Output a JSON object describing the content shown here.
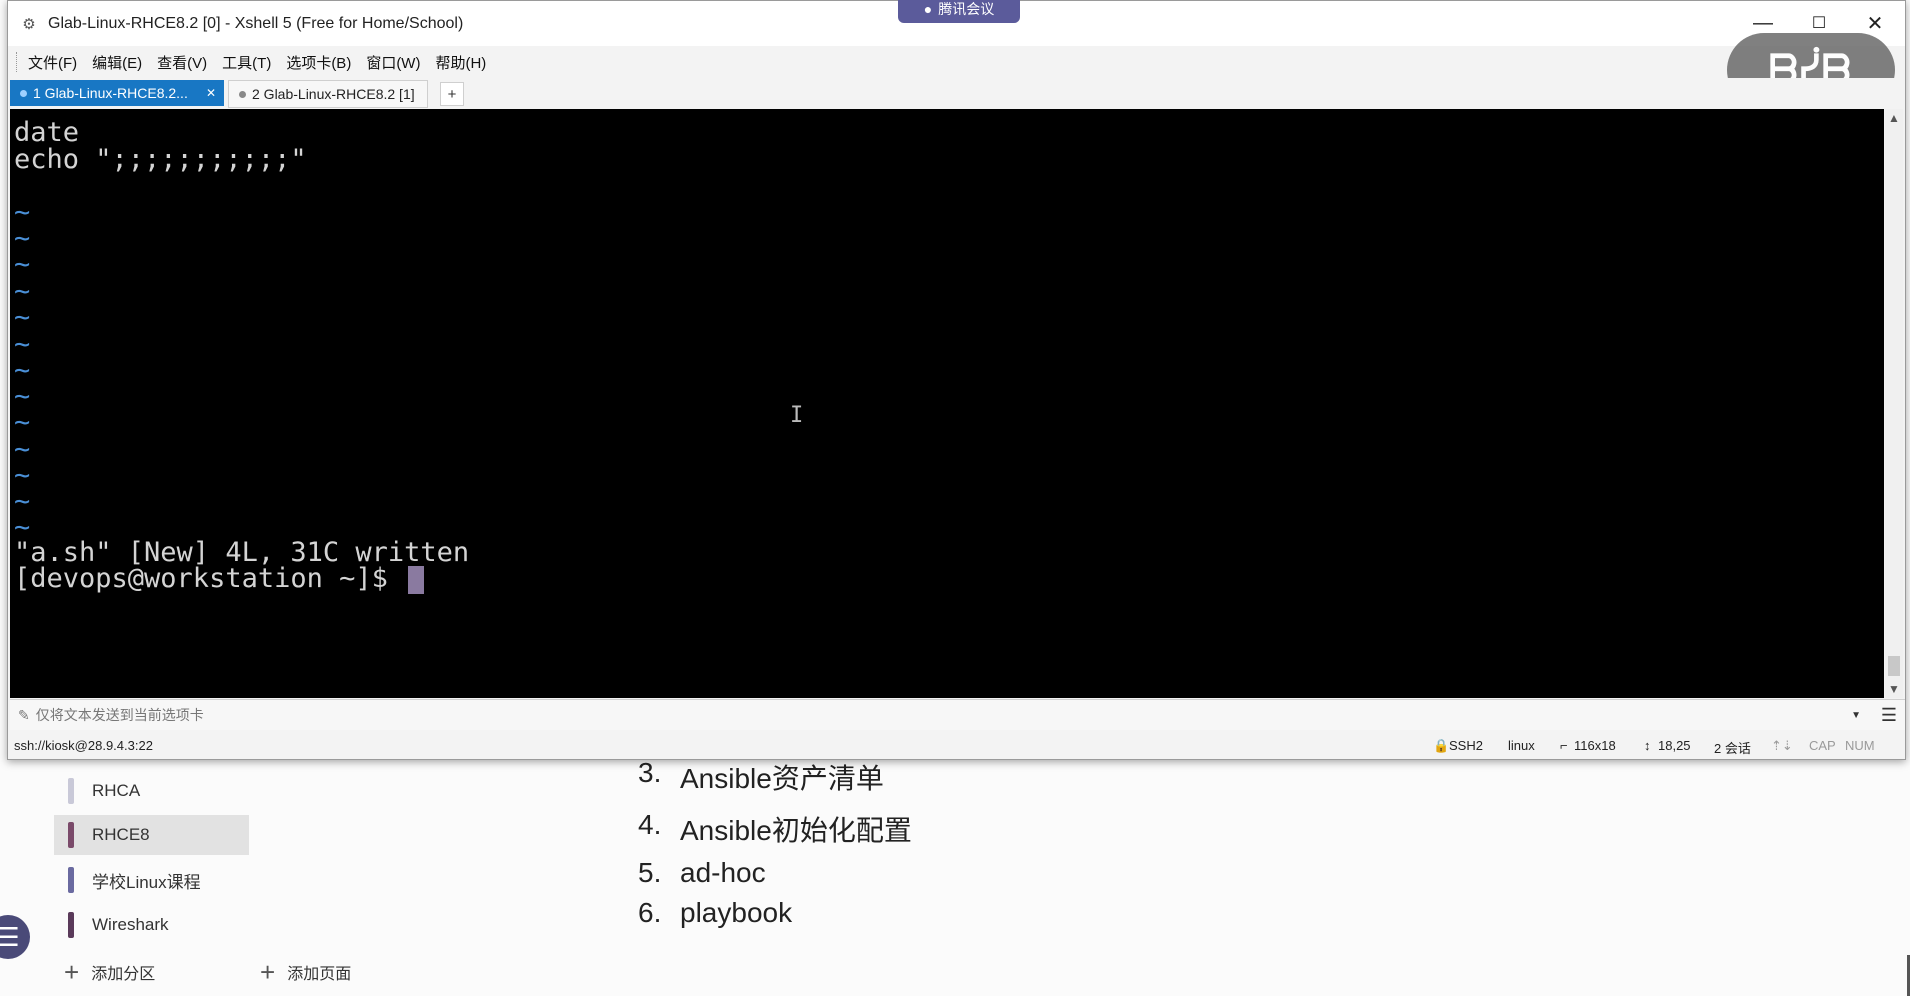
{
  "window": {
    "title": "Glab-Linux-RHCE8.2 [0] - Xshell 5 (Free for Home/School)",
    "meeting_badge": "腾讯会议"
  },
  "menu": [
    "文件(F)",
    "编辑(E)",
    "查看(V)",
    "工具(T)",
    "选项卡(B)",
    "窗口(W)",
    "帮助(H)"
  ],
  "tabs": [
    {
      "label": "1 Glab-Linux-RHCE8.2...",
      "active": true
    },
    {
      "label": "2 Glab-Linux-RHCE8.2 [1]",
      "active": false
    }
  ],
  "terminal": {
    "lines": [
      "date",
      "echo \";;;;;;;;;;;\""
    ],
    "tilde": "~",
    "status_line": "\"a.sh\" [New] 4L, 31C written",
    "prompt": "[devops@workstation ~]$"
  },
  "compose_bar": {
    "placeholder": "仅将文本发送到当前选项卡"
  },
  "statusbar": {
    "connection": "ssh://kiosk@28.9.4.3:22",
    "protocol": "SSH2",
    "term": "linux",
    "size": "116x18",
    "cursor_pos": "18,25",
    "sessions": "2 会话",
    "cap": "CAP",
    "num": "NUM"
  },
  "notebook": {
    "sections": [
      {
        "label": "RHCA",
        "color": "#c9c9d8",
        "active": false
      },
      {
        "label": "RHCE8",
        "color": "#7a4a6a",
        "active": true
      },
      {
        "label": "学校Linux课程",
        "color": "#6a6aa0",
        "active": false
      },
      {
        "label": "Wireshark",
        "color": "#5a3a5a",
        "active": false
      }
    ],
    "add_section": "添加分区",
    "add_page": "添加页面",
    "toc": [
      {
        "num": "3.",
        "text": "Ansible资产清单"
      },
      {
        "num": "4.",
        "text": "Ansible初始化配置"
      },
      {
        "num": "5.",
        "text": "ad-hoc"
      },
      {
        "num": "6.",
        "text": "playbook"
      }
    ]
  }
}
